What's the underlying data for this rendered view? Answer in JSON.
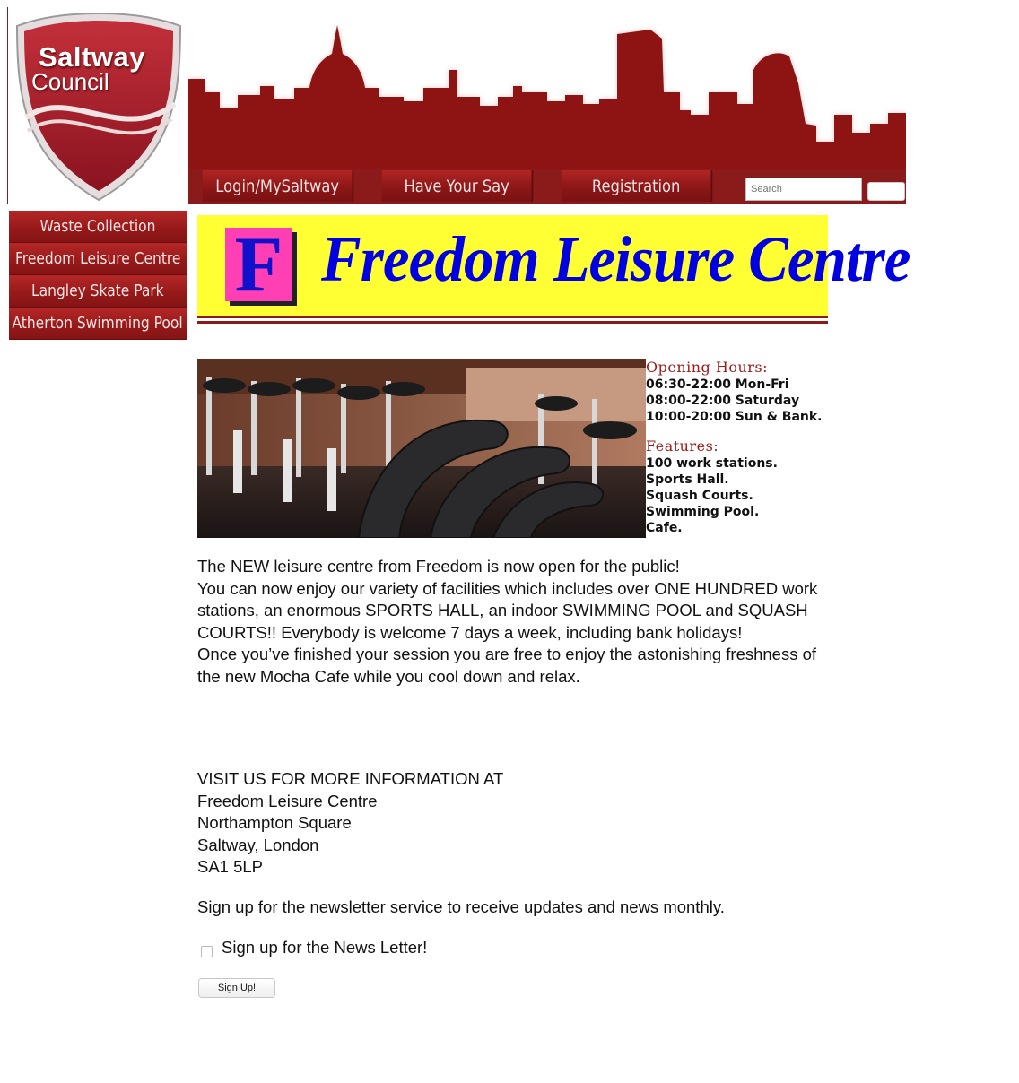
{
  "logo": {
    "line1": "Saltway",
    "line2": "Council"
  },
  "topnav": {
    "items": [
      "Login/MySaltway",
      "Have Your Say",
      "Registration"
    ],
    "search_placeholder": "Search"
  },
  "sidebar": {
    "items": [
      "Waste Collection",
      "Freedom Leisure Centre",
      "Langley Skate Park",
      "Atherton Swimming Pool"
    ]
  },
  "banner": {
    "logo_letter": "F",
    "title": "Freedom Leisure Centre"
  },
  "info": {
    "opening_heading": "Opening Hours:",
    "opening_hours": [
      "06:30-22:00 Mon-Fri",
      "08:00-22:00 Saturday",
      "10:00-20:00 Sun & Bank."
    ],
    "features_heading": "Features:",
    "features": [
      "100 work stations.",
      "Sports Hall.",
      "Squash Courts.",
      "Swimming Pool.",
      "Cafe."
    ]
  },
  "content": {
    "paragraphs": [
      "The NEW leisure centre from Freedom is now open for the public!",
      "You can now enjoy our variety of facilities which includes over ONE HUNDRED work stations, an enormous SPORTS HALL, an indoor SWIMMING POOL and SQUASH COURTS!! Everybody is welcome 7 days a week, including bank holidays!",
      "Once you’ve finished your session you are free to enjoy the astonishing freshness of the new Mocha Cafe while you cool down and relax."
    ],
    "visit_lines": [
      "VISIT US FOR MORE INFORMATION AT",
      "Freedom Leisure Centre",
      "Northampton Square",
      "Saltway, London",
      "SA1 5LP"
    ],
    "newsletter_text": "Sign up for the newsletter service to receive updates and news monthly.",
    "newsletter_checkbox_label": "Sign up for the News Letter!",
    "signup_button": "Sign Up!"
  },
  "colors": {
    "brand": "#8b1a1a",
    "banner_yellow": "#ffff33",
    "banner_text": "#0000e0",
    "logo_f_bg": "#ff3fb3"
  }
}
